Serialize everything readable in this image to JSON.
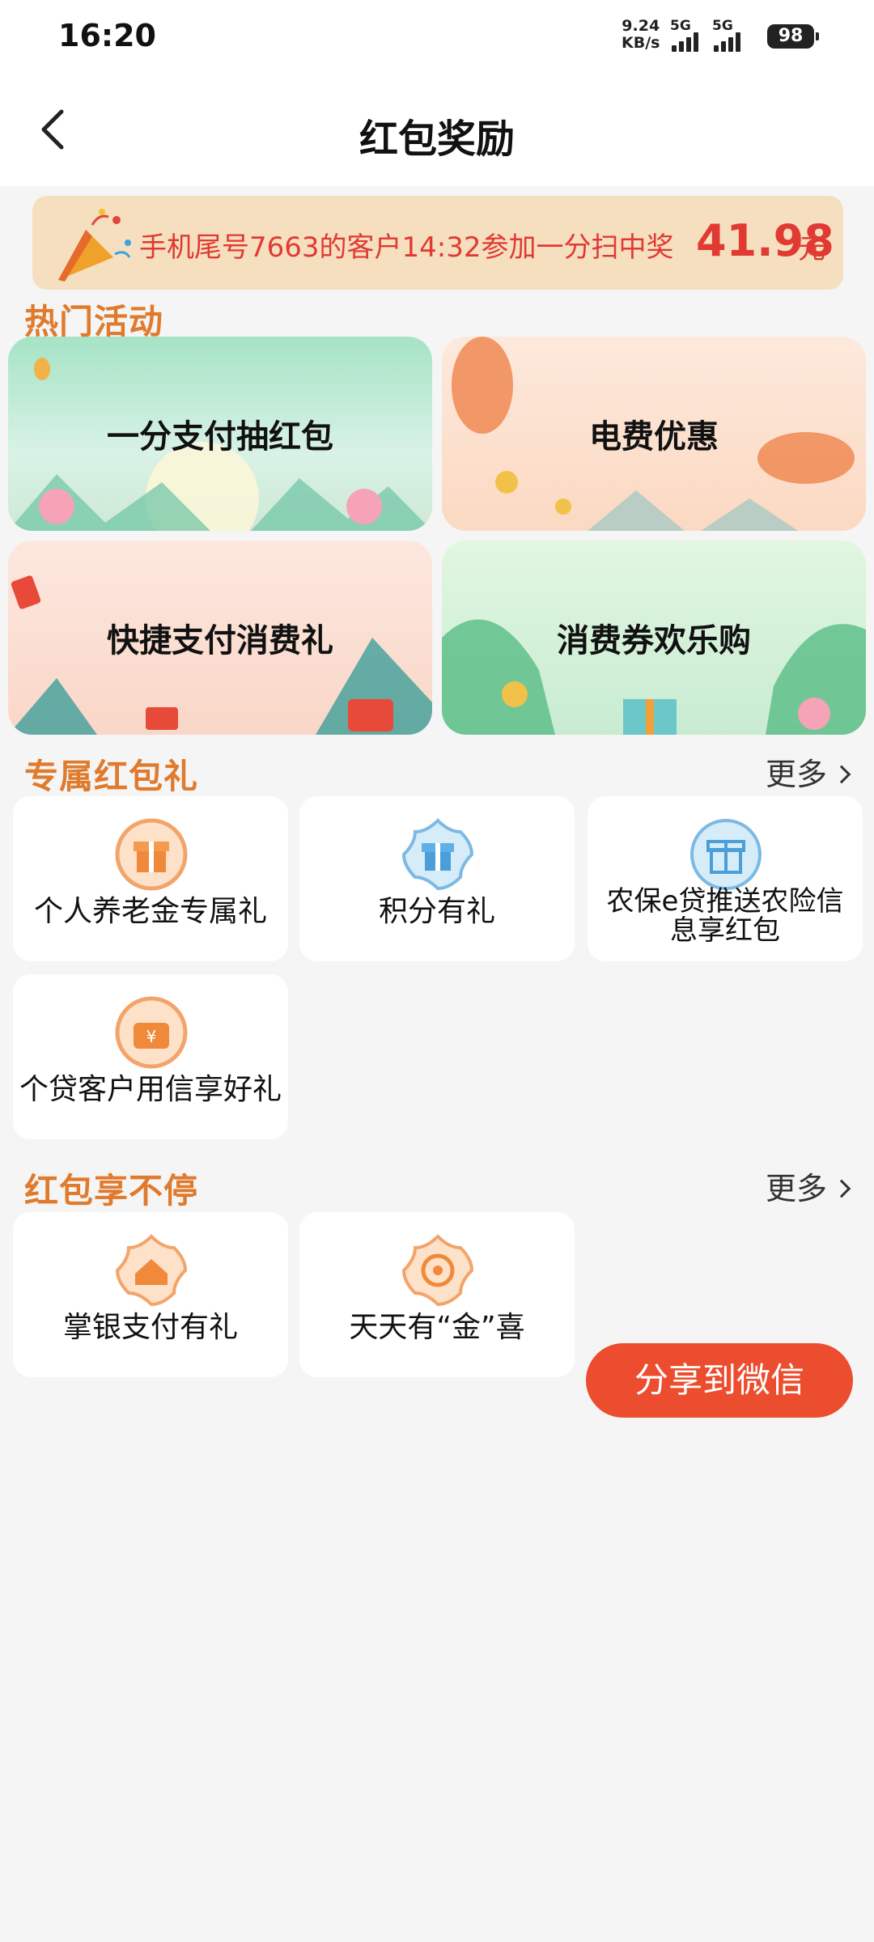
{
  "status_bar": {
    "time": "16:20",
    "net_speed_value": "9.24",
    "net_speed_unit": "KB/s",
    "sim1_label": "5G",
    "sim2_label": "5G",
    "battery": "98"
  },
  "nav": {
    "title": "红包奖励",
    "back_icon": "chevron-left-icon"
  },
  "notice": {
    "message": "手机尾号7663的客户14:32参加一分扫中奖",
    "amount": "41.98",
    "unit": "元",
    "icon": "party-popper-icon"
  },
  "hot_activities": {
    "title": "热门活动",
    "items": [
      {
        "label": "一分支付抽红包"
      },
      {
        "label": "电费优惠"
      },
      {
        "label": "快捷支付消费礼"
      },
      {
        "label": "消费券欢乐购"
      }
    ]
  },
  "exclusive": {
    "title": "专属红包礼",
    "more": "更多",
    "items": [
      {
        "label": "个人养老金专属礼",
        "icon": "gift-orange-icon"
      },
      {
        "label": "积分有礼",
        "icon": "gift-blue-icon"
      },
      {
        "label_line1": "农保e贷推送农险信",
        "label_line2": "息享红包",
        "icon": "gift-blue-icon"
      },
      {
        "label": "个贷客户用信享好礼",
        "icon": "yuan-wallet-icon"
      }
    ]
  },
  "nonstop": {
    "title": "红包享不停",
    "more": "更多",
    "items": [
      {
        "label": "掌银支付有礼",
        "icon": "house-badge-icon"
      },
      {
        "label": "天天有“金”喜",
        "icon": "sun-badge-icon"
      }
    ]
  },
  "share_button": "分享到微信",
  "colors": {
    "accent_orange": "#e07a2c",
    "notice_red": "#e03a32",
    "share_button": "#ec4d2e",
    "notice_bg": "#f5dfbf"
  }
}
